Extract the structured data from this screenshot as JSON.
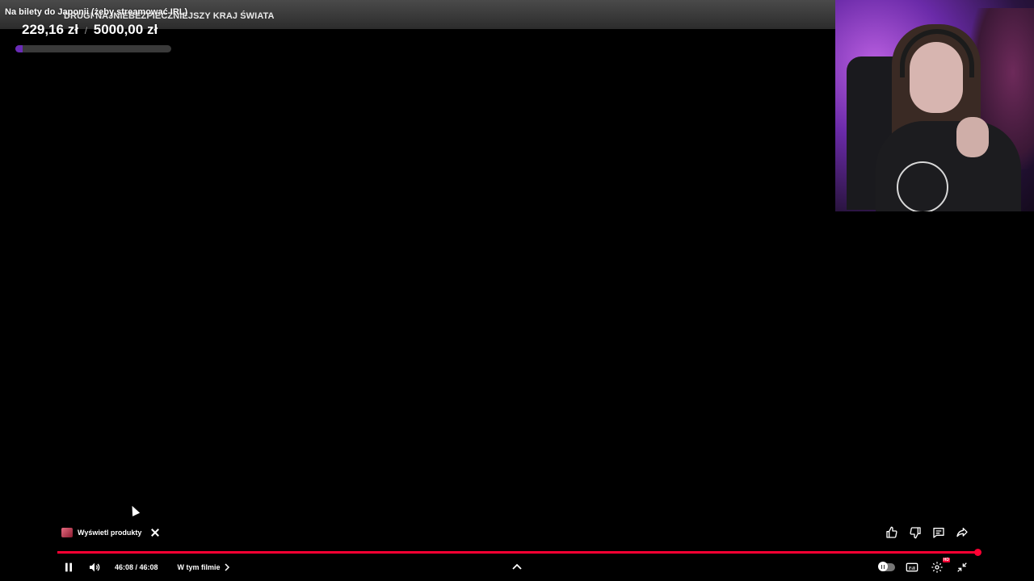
{
  "video": {
    "title": "DRUGI NAJNIEBEZPIECZNIEJSZY KRAJ ŚWIATA"
  },
  "donation_goal": {
    "label": "Na bilety do Japonii (żeby streamować IRL)",
    "current": "229,16 zł",
    "separator": "/",
    "target": "5000,00 zł",
    "progress_fraction": 0.0458,
    "bar_color": "#6a2bb8"
  },
  "products": {
    "label": "Wyświetl produkty",
    "thumb_icon": "product-thumbnail",
    "close_icon": "close-icon"
  },
  "actions": {
    "icons": [
      "thumbs-up-icon",
      "thumbs-down-icon",
      "comment-icon",
      "share-icon"
    ]
  },
  "playback": {
    "current_time": "46:08",
    "duration": "46:08",
    "time_text": "46:08 / 46:08",
    "progress_fraction": 1.0,
    "progress_color": "#ff0033"
  },
  "chapter": {
    "label": "W tym filmie"
  },
  "controls": {
    "left_icons": [
      "pause-icon",
      "volume-icon"
    ],
    "right_icons": [
      "autoplay-toggle",
      "subtitles-icon",
      "settings-icon",
      "exit-fullscreen-icon"
    ],
    "settings_badge": "HD"
  }
}
